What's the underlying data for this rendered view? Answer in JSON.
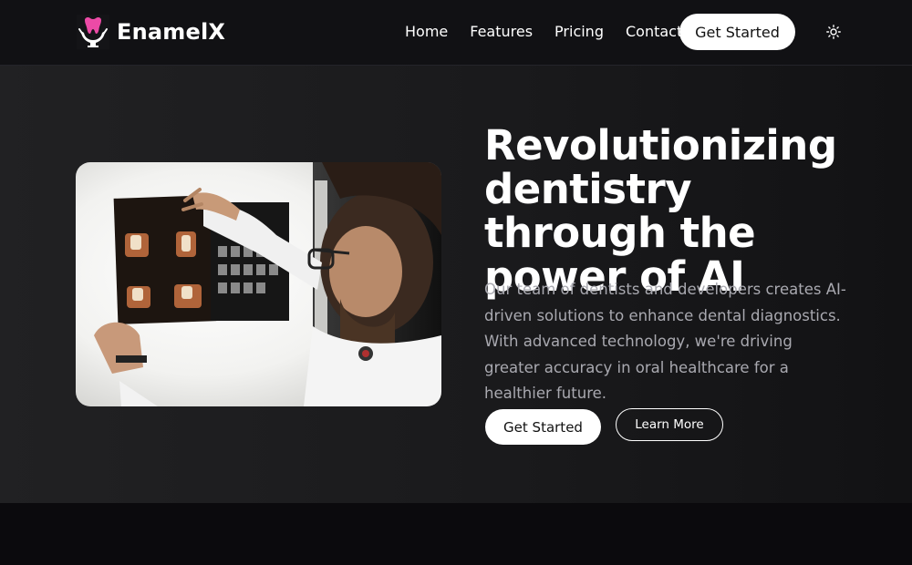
{
  "brand": {
    "name": "EnamelX",
    "logo_icon": "tooth-hands-icon",
    "accent_color": "#ec4aa6"
  },
  "nav": {
    "links": [
      {
        "label": "Home"
      },
      {
        "label": "Features"
      },
      {
        "label": "Pricing"
      },
      {
        "label": "Contact"
      }
    ],
    "cta_label": "Get Started",
    "theme_icon": "sun-icon"
  },
  "hero": {
    "title": "Revolutionizing dentistry through the power of AI",
    "description": "Our team of dentists and developers creates AI-driven solutions to enhance dental diagnostics. With advanced technology, we're driving greater accuracy in oral healthcare for a healthier future.",
    "primary_button": "Get Started",
    "secondary_button": "Learn More",
    "image_icon": "dentist-xray-photo"
  },
  "colors": {
    "navbar_bg": "#111114",
    "hero_bg": "#1e1e20",
    "page_bg": "#0b0a0d",
    "description_text": "#a9a9b0"
  }
}
